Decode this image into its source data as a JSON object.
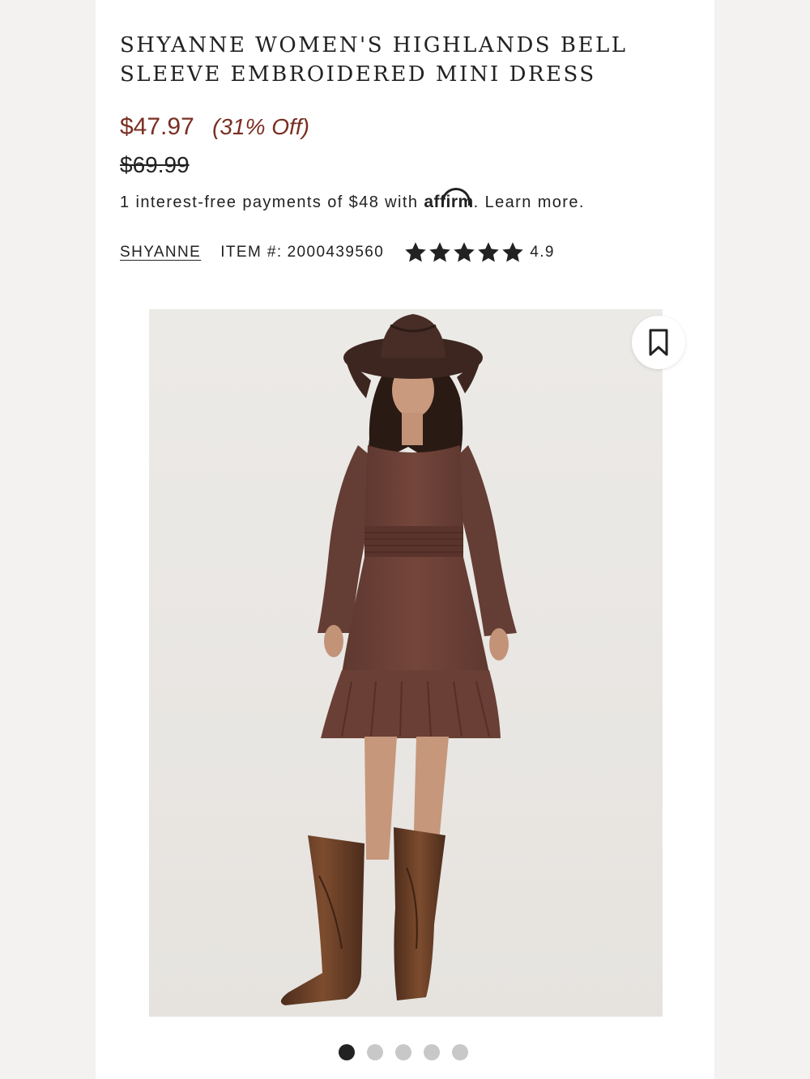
{
  "product": {
    "title": "SHYANNE WOMEN'S HIGHLANDS BELL SLEEVE EMBROIDERED MINI DRESS",
    "sale_price": "$47.97",
    "discount": "(31% Off)",
    "original_price": "$69.99",
    "payments_text": "1 interest-free payments of $48 with",
    "affirm_logo": "affirm",
    "learn_more": ". Learn more.",
    "brand": "SHYANNE",
    "item_label": "ITEM #:",
    "item_number": "2000439560",
    "rating": "4.9",
    "rating_stars": 5
  },
  "colors": {
    "sale_price": "#7a2e22",
    "dress": "#6b4037",
    "hat": "#3d2620",
    "boots": "#6e4126"
  },
  "icons": {
    "bookmark": "bookmark-icon",
    "star": "star-icon"
  },
  "carousel": {
    "total": 5,
    "active": 1
  }
}
